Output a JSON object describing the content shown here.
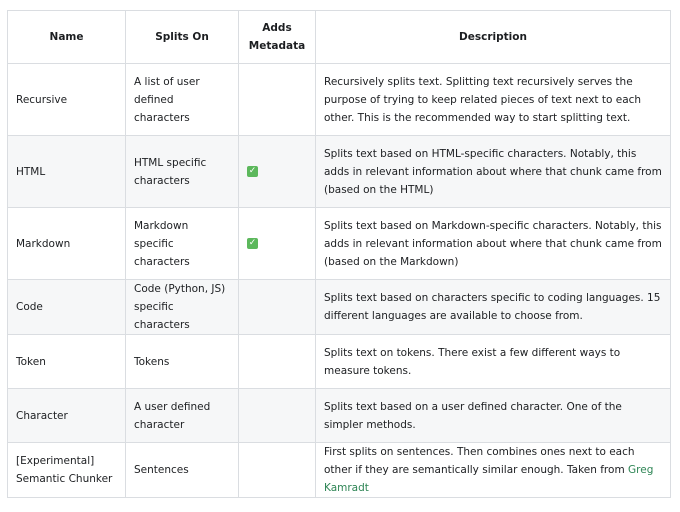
{
  "headers": {
    "name": "Name",
    "splits_on": "Splits On",
    "adds_metadata": "Adds\nMetadata",
    "description": "Description"
  },
  "rows": [
    {
      "name": "Recursive",
      "splits_on": "A list of user\ndefined characters",
      "adds_metadata": false,
      "description": "Recursively splits text. Splitting text recursively serves the purpose of trying to keep related pieces of text next to each other. This is the recommended way to start splitting text."
    },
    {
      "name": "HTML",
      "splits_on": "HTML specific\ncharacters",
      "adds_metadata": true,
      "check": "✓",
      "description": "Splits text based on HTML-specific characters. Notably, this adds in relevant information about where that chunk came from (based on the HTML)"
    },
    {
      "name": "Markdown",
      "splits_on": "Markdown specific\ncharacters",
      "adds_metadata": true,
      "check": "✓",
      "description": "Splits text based on Markdown-specific characters. Notably, this adds in relevant information about where that chunk came from (based on the Markdown)"
    },
    {
      "name": "Code",
      "splits_on": "Code (Python, JS)\nspecific characters",
      "adds_metadata": false,
      "description": "Splits text based on characters specific to coding languages. 15 different languages are available to choose from."
    },
    {
      "name": "Token",
      "splits_on": "Tokens",
      "adds_metadata": false,
      "description": "Splits text on tokens. There exist a few different ways to measure tokens."
    },
    {
      "name": "Character",
      "splits_on": "A user defined\ncharacter",
      "adds_metadata": false,
      "description": "Splits text based on a user defined character. One of the simpler methods."
    },
    {
      "name": "[Experimental]\nSemantic Chunker",
      "splits_on": "Sentences",
      "adds_metadata": false,
      "description": "First splits on sentences. Then combines ones next to each other if they are semantically similar enough. Taken from ",
      "link_text": "Greg Kamradt"
    }
  ],
  "colors": {
    "border": "#dadde1",
    "stripe": "#f6f7f8",
    "check": "#5cb85c",
    "link": "#2e8555"
  }
}
